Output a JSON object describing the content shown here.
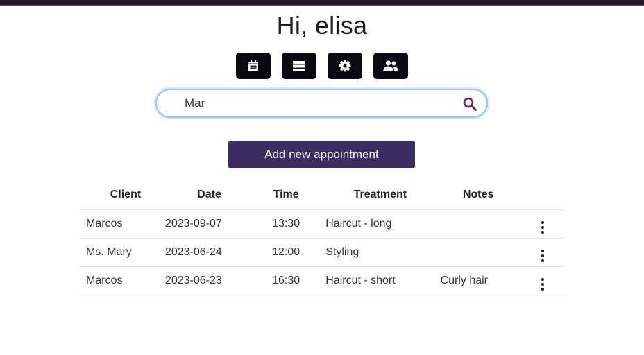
{
  "greeting": "Hi, elisa",
  "toolbar": {
    "icons": [
      "calendar-icon",
      "table-icon",
      "gear-icon",
      "users-icon"
    ]
  },
  "search": {
    "value": "Mar",
    "placeholder": ""
  },
  "add_button_label": "Add new appointment",
  "table": {
    "headers": {
      "client": "Client",
      "date": "Date",
      "time": "Time",
      "treatment": "Treatment",
      "notes": "Notes"
    },
    "rows": [
      {
        "client": "Marcos",
        "date": "2023-09-07",
        "time": "13:30",
        "treatment": "Haircut - long",
        "notes": ""
      },
      {
        "client": "Ms. Mary",
        "date": "2023-06-24",
        "time": "12:00",
        "treatment": "Styling",
        "notes": ""
      },
      {
        "client": "Marcos",
        "date": "2023-06-23",
        "time": "16:30",
        "treatment": "Haircut - short",
        "notes": "Curly hair"
      }
    ]
  },
  "colors": {
    "accent": "#3d2c61",
    "search_icon": "#6b2d5c",
    "icon_button_bg": "#0c0a10",
    "focus_ring": "#9ec3f3"
  }
}
